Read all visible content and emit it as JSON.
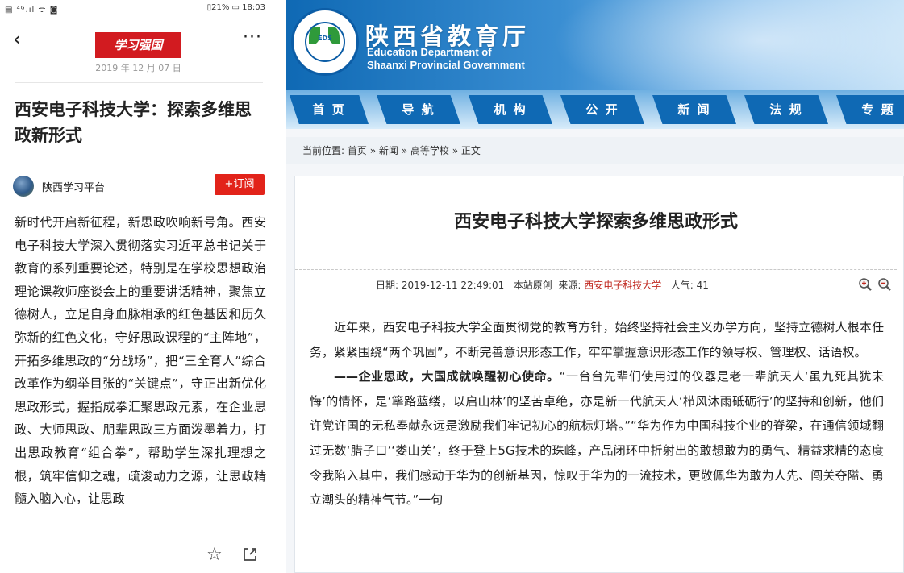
{
  "mobile": {
    "status_left": "▤ ⁴ᴳ.ıl ᯤ ◙",
    "status_right": "▯21% ▭ 18:03",
    "logo_text": "学习强国",
    "date": "2019 年 12 月 07 日",
    "title": "西安电子科技大学：探索多维思政新形式",
    "author": "陕西学习平台",
    "subscribe_label": "+订阅",
    "body": "新时代开启新征程，新思政吹响新号角。西安电子科技大学深入贯彻落实习近平总书记关于教育的系列重要论述，特别是在学校思想政治理论课教师座谈会上的重要讲话精神，聚焦立德树人，立足自身血脉相承的红色基因和历久弥新的红色文化，守好思政课程的“主阵地”，开拓多维思政的“分战场”，把“三全育人”综合改革作为纲举目张的“关键点”，守正出新优化思政形式，握指成拳汇聚思政元素，在企业思政、大师思政、朋辈思政三方面泼墨着力，打出思政教育“组合拳”，帮助学生深扎理想之根，筑牢信仰之魂，疏浚动力之源，让思政精髓入脑入心，让思政",
    "icons": {
      "back": "back-arrow-icon",
      "more": "more-icon",
      "star": "star-icon",
      "share": "share-icon"
    }
  },
  "site": {
    "title_cn": "陕西省教育厅",
    "title_en_1": "Education Department of",
    "title_en_2": "Shaanxi Provincial Government",
    "emblem_text": "EDS",
    "nav": [
      "首 页",
      "导 航",
      "机 构",
      "公 开",
      "新 闻",
      "法 规",
      "专 题"
    ],
    "breadcrumb": {
      "prefix": "当前位置: ",
      "items": [
        "首页",
        "新闻",
        "高等学校",
        "正文"
      ],
      "separator": " » "
    },
    "article": {
      "title": "西安电子科技大学探索多维思政形式",
      "meta_date_label": "日期: ",
      "meta_date": "2019-12-11 22:49:01",
      "meta_original": "本站原创",
      "meta_source_label": "来源: ",
      "meta_source": "西安电子科技大学",
      "meta_views_label": "人气: ",
      "meta_views": "41",
      "para1": "近年来，西安电子科技大学全面贯彻党的教育方针，始终坚持社会主义办学方向，坚持立德树人根本任务，紧紧围绕“两个巩固”，不断完善意识形态工作，牢牢掌握意识形态工作的领导权、管理权、话语权。",
      "para2_bold": "——企业思政，大国成就唤醒初心使命。",
      "para2_rest": "“一台台先辈们使用过的仪器是老一辈航天人‘虽九死其犹未悔’的情怀，是‘筚路蓝缕，以启山林’的坚苦卓绝，亦是新一代航天人‘栉风沐雨砥砺行’的坚持和创新，他们许党许国的无私奉献永远是激励我们牢记初心的航标灯塔。”“华为作为中国科技企业的脊梁，在通信领域翻过无数‘腊子口’‘娄山关’，终于登上5G技术的珠峰，产品闭环中折射出的敢想敢为的勇气、精益求精的态度令我陷入其中，我们感动于华为的创新基因，惊叹于华为的一流技术，更敬佩华为敢为人先、闯关夺隘、勇立潮头的精神气节。”一句"
    },
    "colors": {
      "nav_blue": "#0f69b4",
      "source_red": "#c0281f",
      "subscribe_red": "#e2231a",
      "logo_red": "#d21b20"
    }
  }
}
